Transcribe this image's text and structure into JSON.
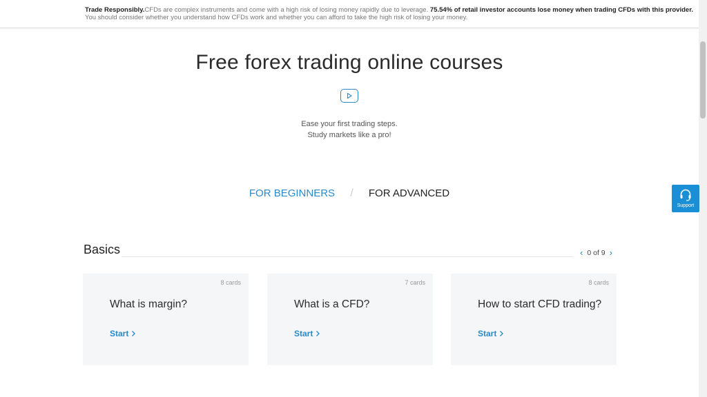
{
  "risk_banner": {
    "lead": "Trade Responsibly.",
    "text1": "CFDs are complex instruments and come with a high risk of losing money rapidly due to leverage. ",
    "bold": "75.54% of retail investor accounts lose money when trading CFDs with this provider.",
    "text2": " You should consider whether you understand how CFDs work and whether you can afford to take the high risk of losing your money."
  },
  "hero": {
    "title": "Free forex trading online courses",
    "play_icon": "play-icon",
    "subtitle_line1": "Ease your first trading steps.",
    "subtitle_line2": "Study markets like a pro!"
  },
  "tabs": {
    "beginners": "FOR BEGINNERS",
    "separator": "/",
    "advanced": "FOR ADVANCED",
    "active": "beginners"
  },
  "section": {
    "title": "Basics",
    "pager_text": "0 of 9",
    "prev_icon": "chevron-left-icon",
    "next_icon": "chevron-right-icon"
  },
  "cards": [
    {
      "count": "8 cards",
      "title": "What is margin?",
      "start": "Start"
    },
    {
      "count": "7 cards",
      "title": "What is a CFD?",
      "start": "Start"
    },
    {
      "count": "8 cards",
      "title": "How to start CFD trading?",
      "start": "Start"
    }
  ],
  "support": {
    "label": "Support",
    "icon": "headset-icon"
  },
  "colors": {
    "accent": "#2a8ac7",
    "support_bg": "#1a8fd6",
    "card_bg": "#f4f6f8"
  }
}
